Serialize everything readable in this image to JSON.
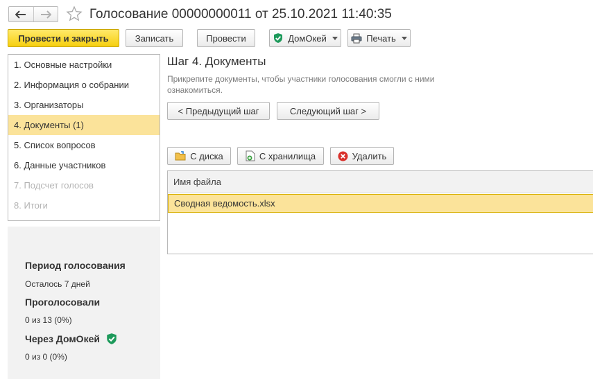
{
  "window": {
    "title": "Голосование 00000000011 от 25.10.2021 11:40:35"
  },
  "toolbar": {
    "post_and_close": "Провести и закрыть",
    "save": "Записать",
    "post": "Провести",
    "domokey": "ДомОкей",
    "print": "Печать"
  },
  "steps": [
    {
      "label": "1. Основные настройки",
      "state": "normal"
    },
    {
      "label": "2. Информация о собрании",
      "state": "normal"
    },
    {
      "label": "3. Организаторы",
      "state": "normal"
    },
    {
      "label": "4. Документы (1)",
      "state": "active"
    },
    {
      "label": "5. Список вопросов",
      "state": "normal"
    },
    {
      "label": "6. Данные участников",
      "state": "normal"
    },
    {
      "label": "7. Подсчет голосов",
      "state": "disabled"
    },
    {
      "label": "8. Итоги",
      "state": "disabled"
    }
  ],
  "info": {
    "period_title": "Период голосования",
    "period_value": "Осталось 7 дней",
    "voted_title": "Проголосовали",
    "voted_value": "0 из 13 (0%)",
    "domokey_title": "Через ДомОкей",
    "domokey_value": "0 из 0 (0%)"
  },
  "main": {
    "step_title": "Шаг 4. Документы",
    "hint": "Прикрепите документы, чтобы участники голосования смогли с ними ознакомиться.",
    "prev_step": "< Предыдущий шаг",
    "next_step": "Следующий шаг >",
    "from_disk": "С диска",
    "from_storage": "С хранилища",
    "delete": "Удалить",
    "files_column": "Имя файла",
    "files": [
      "Сводная ведомость.xlsx"
    ]
  },
  "colors": {
    "primary_button": "#f6cf0f",
    "selection": "#fbe39a",
    "domokey_green": "#1d9a5b",
    "delete_red": "#d9312c"
  }
}
